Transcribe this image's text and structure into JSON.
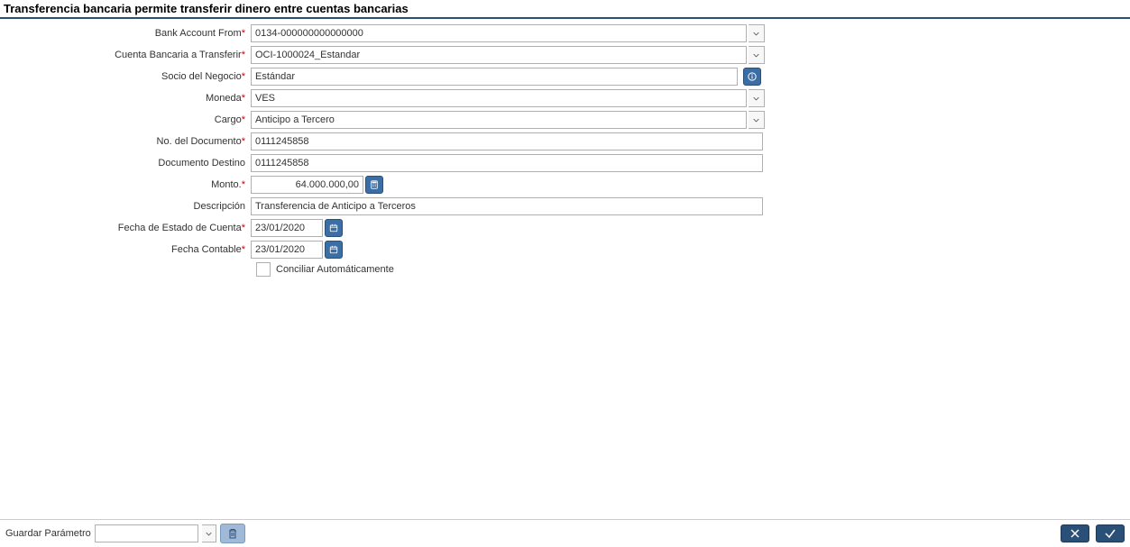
{
  "title": "Transferencia bancaria permite transferir dinero entre cuentas bancarias",
  "labels": {
    "bank_from": "Bank Account From",
    "bank_to": "Cuenta Bancaria a Transferir",
    "bpartner": "Socio del Negocio",
    "currency": "Moneda",
    "charge": "Cargo",
    "doc_no": "No. del Documento",
    "doc_target": "Documento Destino",
    "amount": "Monto.",
    "description": "Descripción",
    "stmt_date": "Fecha de Estado de Cuenta",
    "acct_date": "Fecha Contable",
    "auto_reconcile": "Conciliar Automáticamente",
    "save_param": "Guardar Parámetro"
  },
  "values": {
    "bank_from": "0134-000000000000000",
    "bank_to": "OCI-1000024_Estandar",
    "bpartner": "Estándar",
    "currency": "VES",
    "charge": "Anticipo a Tercero",
    "doc_no": "0111245858",
    "doc_target": "0111245858",
    "amount": "64.000.000,00",
    "description": "Transferencia de Anticipo a Terceros",
    "stmt_date": "23/01/2020",
    "acct_date": "23/01/2020"
  }
}
